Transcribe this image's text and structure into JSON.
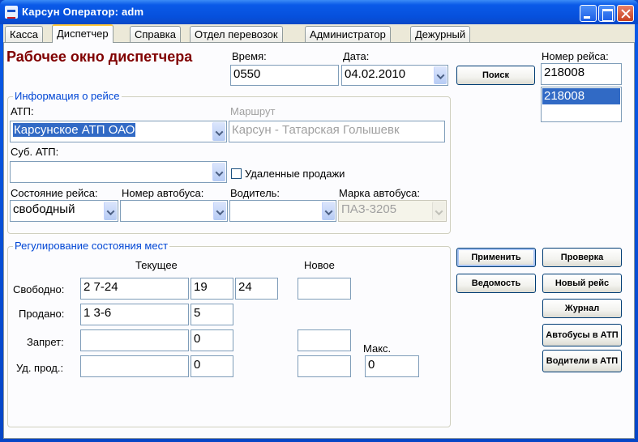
{
  "window": {
    "title": "Карсун  Оператор: adm"
  },
  "tabs": [
    {
      "label": "Касса"
    },
    {
      "label": "Диспетчер"
    },
    {
      "label": "Справка"
    },
    {
      "label": "Отдел перевозок"
    },
    {
      "label": "Администратор"
    },
    {
      "label": "Дежурный"
    }
  ],
  "page": {
    "heading": "Рабочее окно диспетчера",
    "time_label": "Время:",
    "time_value": "0550",
    "date_label": "Дата:",
    "date_value": "04.02.2010",
    "search_label": "Поиск",
    "trip_number_label": "Номер рейса:",
    "trip_number_value": "218008",
    "trip_list": [
      "218008"
    ]
  },
  "trip_info": {
    "title": "Информация о рейсе",
    "atp_label": "АТП:",
    "atp_value": "Карсунское АТП ОАО",
    "route_label": "Маршрут",
    "route_value": "Карсун - Татарская Голышевк",
    "sub_atp_label": "Суб. АТП:",
    "sub_atp_value": "",
    "remote_sales_label": "Удаленные продажи",
    "remote_sales_checked": false,
    "trip_state_label": "Состояние рейса:",
    "trip_state_value": "свободный",
    "bus_number_label": "Номер автобуса:",
    "bus_number_value": "",
    "driver_label": "Водитель:",
    "driver_value": "",
    "bus_brand_label": "Марка автобуса:",
    "bus_brand_value": "ПАЗ-3205"
  },
  "seats": {
    "title": "Регулирование состояния мест",
    "current_label": "Текущее",
    "new_label": "Новое",
    "max_label": "Макс.",
    "max_value": "0",
    "rows": {
      "free": {
        "label": "Свободно:",
        "list": "2 7-24",
        "count": "19",
        "extra": "24",
        "new": ""
      },
      "sold": {
        "label": "Продано:",
        "list": "1 3-6",
        "count": "5"
      },
      "banned": {
        "label": "Запрет:",
        "list": "",
        "count": "0",
        "new": ""
      },
      "remote": {
        "label": "Уд. прод.:",
        "list": "",
        "count": "0",
        "new": ""
      }
    }
  },
  "buttons": {
    "apply": "Применить",
    "check": "Проверка",
    "statement": "Ведомость",
    "new_trip": "Новый рейс",
    "journal": "Журнал",
    "buses_in_atp": "Автобусы в АТП",
    "drivers_in_atp": "Водители в АТП"
  }
}
